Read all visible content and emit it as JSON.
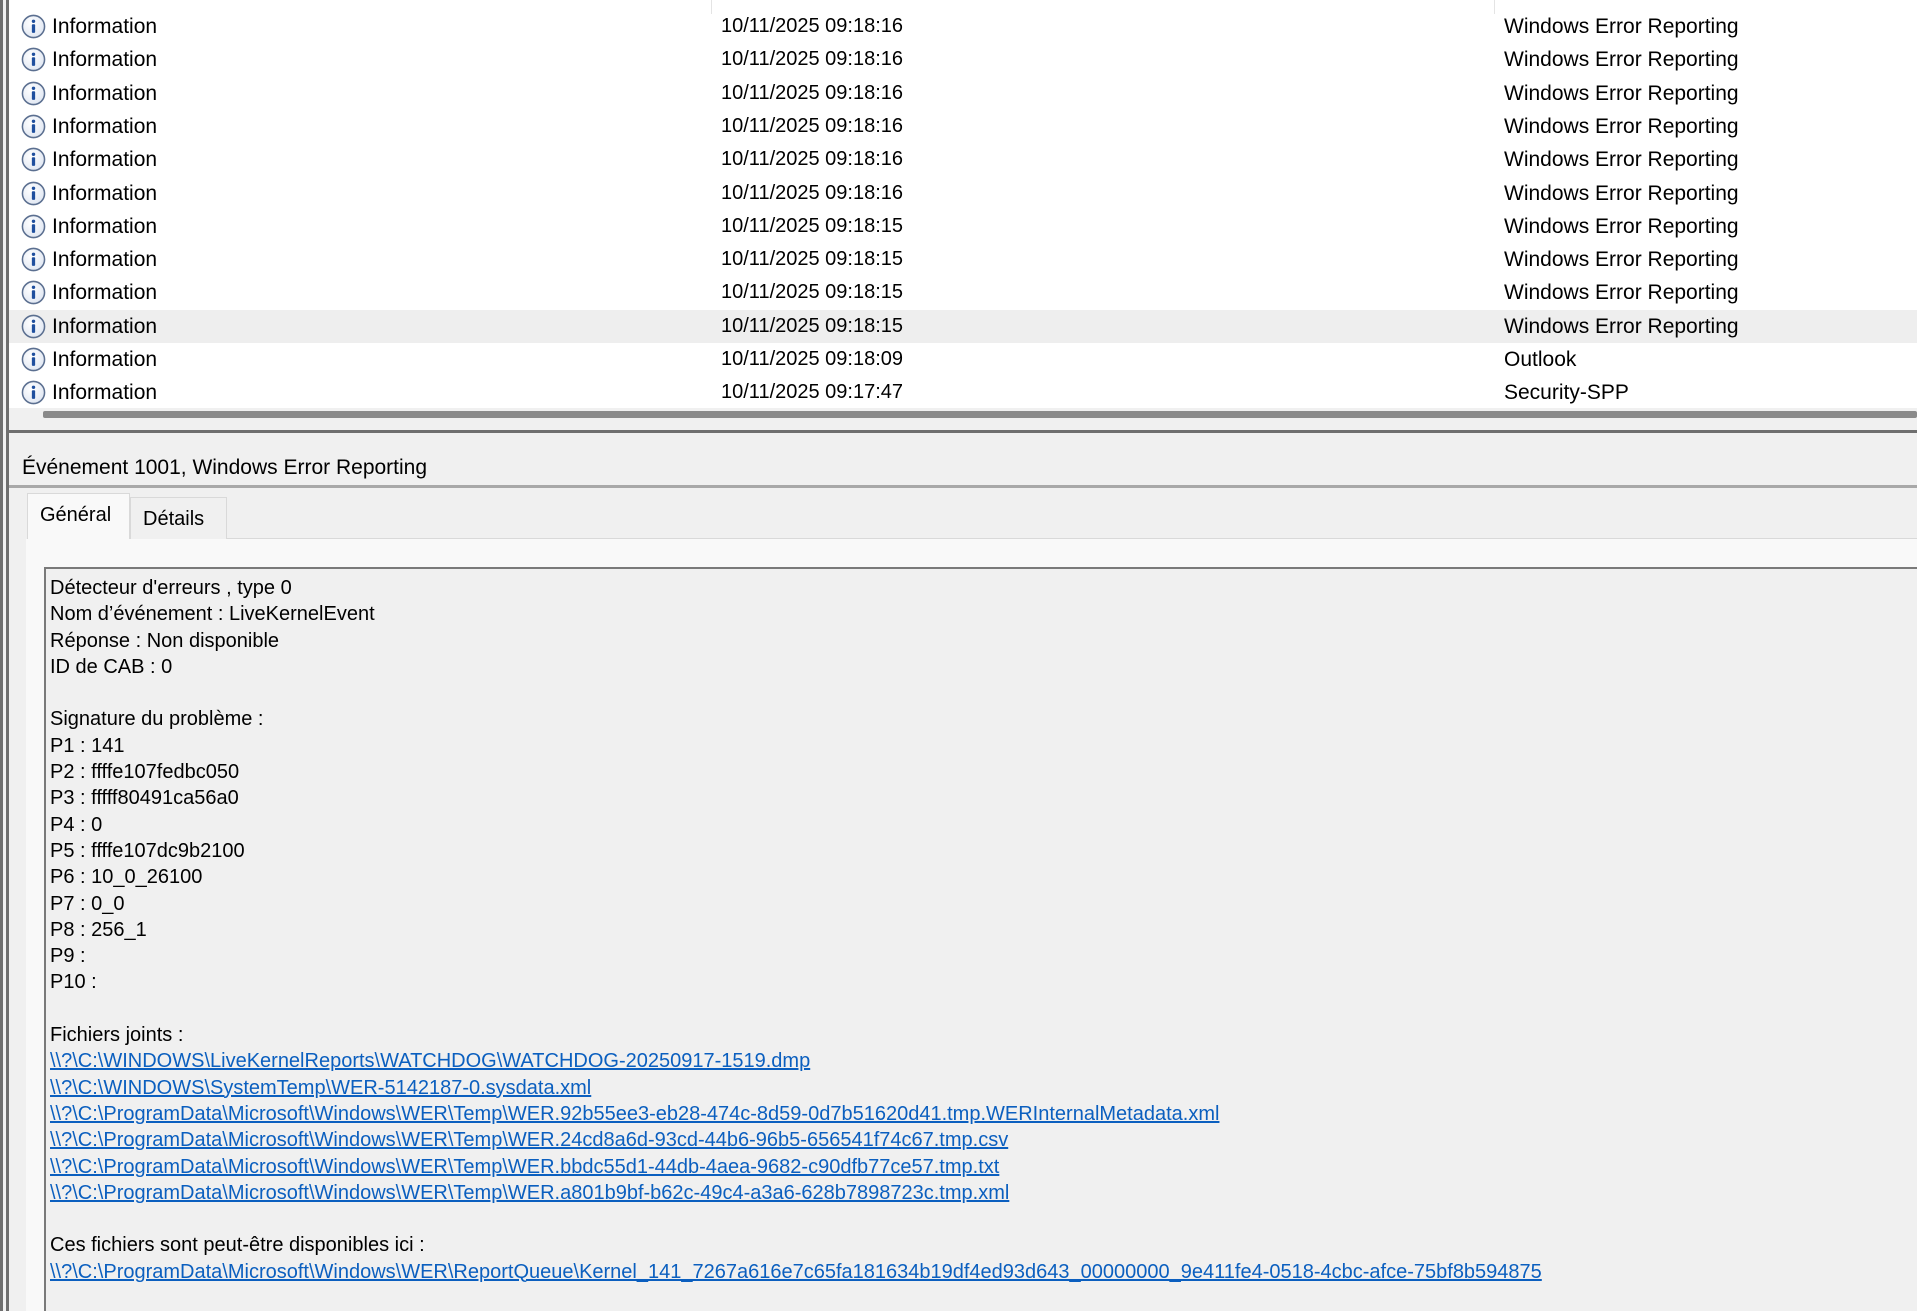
{
  "event_list": {
    "rows": [
      {
        "level": "Information",
        "date": "10/11/2025 09:18:16",
        "source": "Windows Error Reporting",
        "selected": false
      },
      {
        "level": "Information",
        "date": "10/11/2025 09:18:16",
        "source": "Windows Error Reporting",
        "selected": false
      },
      {
        "level": "Information",
        "date": "10/11/2025 09:18:16",
        "source": "Windows Error Reporting",
        "selected": false
      },
      {
        "level": "Information",
        "date": "10/11/2025 09:18:16",
        "source": "Windows Error Reporting",
        "selected": false
      },
      {
        "level": "Information",
        "date": "10/11/2025 09:18:16",
        "source": "Windows Error Reporting",
        "selected": false
      },
      {
        "level": "Information",
        "date": "10/11/2025 09:18:16",
        "source": "Windows Error Reporting",
        "selected": false
      },
      {
        "level": "Information",
        "date": "10/11/2025 09:18:15",
        "source": "Windows Error Reporting",
        "selected": false
      },
      {
        "level": "Information",
        "date": "10/11/2025 09:18:15",
        "source": "Windows Error Reporting",
        "selected": false
      },
      {
        "level": "Information",
        "date": "10/11/2025 09:18:15",
        "source": "Windows Error Reporting",
        "selected": false
      },
      {
        "level": "Information",
        "date": "10/11/2025 09:18:15",
        "source": "Windows Error Reporting",
        "selected": true
      },
      {
        "level": "Information",
        "date": "10/11/2025 09:18:09",
        "source": "Outlook",
        "selected": false
      },
      {
        "level": "Information",
        "date": "10/11/2025 09:17:47",
        "source": "Security-SPP",
        "selected": false
      }
    ]
  },
  "detail": {
    "title": "Événement 1001, Windows Error Reporting",
    "tabs": {
      "general": "Général",
      "details": "Détails"
    },
    "lines": [
      {
        "text": "Détecteur d'erreurs , type 0",
        "link": false
      },
      {
        "text": "Nom d’événement : LiveKernelEvent",
        "link": false
      },
      {
        "text": "Réponse : Non disponible",
        "link": false
      },
      {
        "text": "ID de CAB : 0",
        "link": false
      },
      {
        "text": "",
        "link": false
      },
      {
        "text": "Signature du problème :",
        "link": false
      },
      {
        "text": "P1 : 141",
        "link": false
      },
      {
        "text": "P2 : ffffe107fedbc050",
        "link": false
      },
      {
        "text": "P3 : fffff80491ca56a0",
        "link": false
      },
      {
        "text": "P4 : 0",
        "link": false
      },
      {
        "text": "P5 : ffffe107dc9b2100",
        "link": false
      },
      {
        "text": "P6 : 10_0_26100",
        "link": false
      },
      {
        "text": "P7 : 0_0",
        "link": false
      },
      {
        "text": "P8 : 256_1",
        "link": false
      },
      {
        "text": "P9 :",
        "link": false
      },
      {
        "text": "P10 :",
        "link": false
      },
      {
        "text": "",
        "link": false
      },
      {
        "text": "Fichiers joints :",
        "link": false
      },
      {
        "text": "\\\\?\\C:\\WINDOWS\\LiveKernelReports\\WATCHDOG\\WATCHDOG-20250917-1519.dmp",
        "link": true
      },
      {
        "text": "\\\\?\\C:\\WINDOWS\\SystemTemp\\WER-5142187-0.sysdata.xml",
        "link": true
      },
      {
        "text": "\\\\?\\C:\\ProgramData\\Microsoft\\Windows\\WER\\Temp\\WER.92b55ee3-eb28-474c-8d59-0d7b51620d41.tmp.WERInternalMetadata.xml",
        "link": true
      },
      {
        "text": "\\\\?\\C:\\ProgramData\\Microsoft\\Windows\\WER\\Temp\\WER.24cd8a6d-93cd-44b6-96b5-656541f74c67.tmp.csv",
        "link": true
      },
      {
        "text": "\\\\?\\C:\\ProgramData\\Microsoft\\Windows\\WER\\Temp\\WER.bbdc55d1-44db-4aea-9682-c90dfb77ce57.tmp.txt",
        "link": true
      },
      {
        "text": "\\\\?\\C:\\ProgramData\\Microsoft\\Windows\\WER\\Temp\\WER.a801b9bf-b62c-49c4-a3a6-628b7898723c.tmp.xml",
        "link": true
      },
      {
        "text": "",
        "link": false
      },
      {
        "text": "Ces fichiers sont peut-être disponibles ici :",
        "link": false
      },
      {
        "text": "\\\\?\\C:\\ProgramData\\Microsoft\\Windows\\WER\\ReportQueue\\Kernel_141_7267a616e7c65fa181634b19df4ed93d643_00000000_9e411fe4-0518-4cbc-afce-75bf8b594875",
        "link": true
      }
    ]
  },
  "icons": {
    "info": "info-icon"
  },
  "colors": {
    "link": "#0b5fbf",
    "selected_row": "#eeeeee",
    "panel_bg": "#f0f0f0"
  }
}
